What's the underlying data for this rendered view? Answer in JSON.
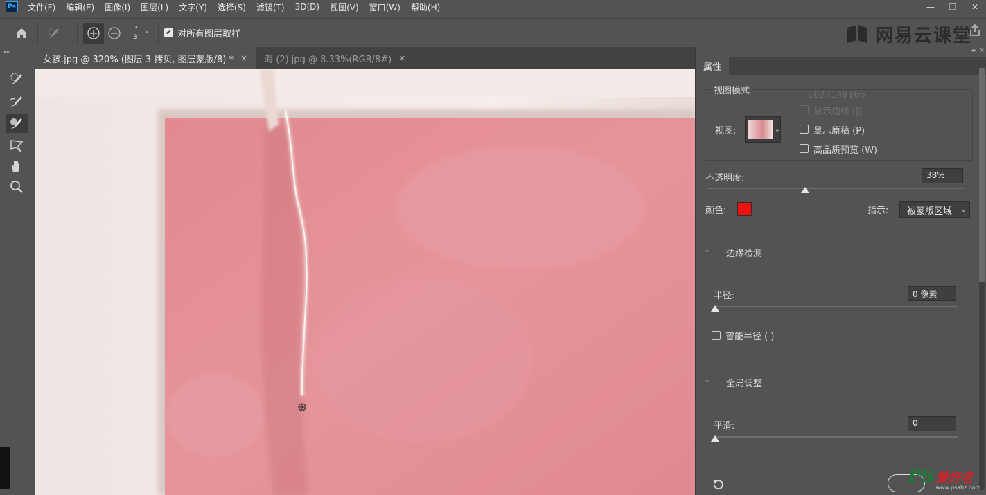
{
  "app": {
    "logo_text": "Ps"
  },
  "menu": [
    "文件(F)",
    "编辑(E)",
    "图像(I)",
    "图层(L)",
    "文字(Y)",
    "选择(S)",
    "滤镜(T)",
    "3D(D)",
    "视图(V)",
    "窗口(W)",
    "帮助(H)"
  ],
  "window_controls": {
    "minimize": "—",
    "restore": "❐",
    "close": "✕"
  },
  "options": {
    "brush_size": "3",
    "sample_all_layers_label": "对所有图层取样",
    "sample_all_layers_checked": true
  },
  "watermark_logo": "网易云课堂",
  "tabs": [
    {
      "title": "女孩.jpg @ 320% (图层 3 拷贝, 图层蒙版/8) *",
      "close": "×",
      "active": true
    },
    {
      "title": "海 (2).jpg @ 8.33%(RGB/8#)",
      "close": "×",
      "active": false
    }
  ],
  "panel": {
    "tab": "属性",
    "view_mode": {
      "section_label": "视图模式",
      "overlay_number": "1027148166",
      "view_label": "视图:",
      "show_edge_label": "显示边缘 (J)",
      "show_original_label": "显示原稿 (P)",
      "hq_preview_label": "高品质预览 (W)"
    },
    "opacity": {
      "label": "不透明度:",
      "value": "38%",
      "fraction": 0.38
    },
    "color": {
      "label": "颜色:",
      "swatch": "#ee1111"
    },
    "indicate": {
      "label": "指示:",
      "value": "被蒙版区域"
    },
    "edge_detection": {
      "title": "边缘检测",
      "radius_label": "半径:",
      "radius_value": "0 像素",
      "smart_radius_label": "智能半径 (  )"
    },
    "global_refine": {
      "title": "全局调整",
      "smooth_label": "平滑:",
      "smooth_value": "0"
    }
  },
  "site_watermark": {
    "ps": "PS",
    "rest": "爱好者",
    "url": "www.psahz.com"
  },
  "colors": {
    "canvas_pink": "#e38d92",
    "ui_bg": "#535353",
    "accent": "#31a8ff"
  }
}
